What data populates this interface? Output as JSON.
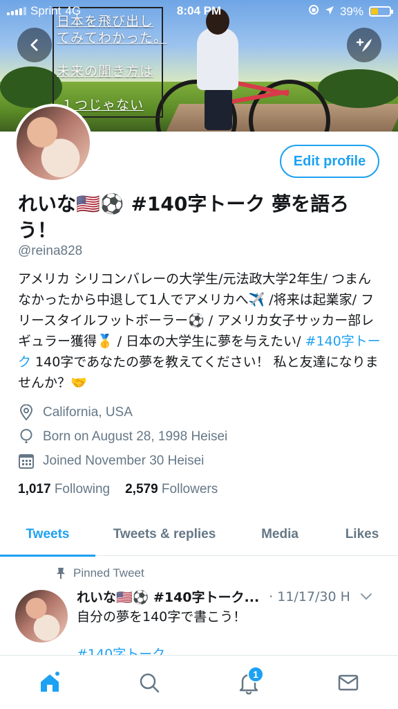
{
  "status_bar": {
    "carrier": "Sprint",
    "network": "4G",
    "time": "8:04 PM",
    "battery_percent": "39%",
    "battery_level": 0.39
  },
  "banner": {
    "lines": [
      "日本を飛び出し",
      "てみてわかった。",
      "未来の開き方は",
      "１つじゃない"
    ]
  },
  "profile": {
    "edit_label": "Edit profile",
    "name": "れいな🇺🇸⚽️ #140字トーク 夢を語ろう！",
    "handle": "@reina828",
    "bio_text": "アメリカ シリコンバレーの大学生/元法政大学2年生/ つまんなかったから中退して1人でアメリカへ✈️ /将来は起業家/ フリースタイルフットボーラー⚽️ / アメリカ女子サッカー部レギュラー獲得🥇 / 日本の大学生に夢を与えたい/ ",
    "bio_hashtag": "#140字トーク",
    "bio_text_after": " 140字であなたの夢を教えてください！ 私と友達になりませんか？🤝",
    "location": "California, USA",
    "birthday": "Born on August 28, 1998 Heisei",
    "joined": "Joined November 30 Heisei",
    "following_count": "1,017",
    "following_label": "Following",
    "followers_count": "2,579",
    "followers_label": "Followers"
  },
  "tabs": [
    "Tweets",
    "Tweets & replies",
    "Media",
    "Likes"
  ],
  "pinned_tweet": {
    "label": "Pinned Tweet",
    "author": "れいな🇺🇸⚽️ #140字トーク...",
    "date": "· 11/17/30 H",
    "text": "自分の夢を140字で書こう！",
    "hashtag": "#140字トーク"
  },
  "bottom_nav": {
    "notification_badge": "1"
  },
  "colors": {
    "accent": "#1da1f2",
    "secondary_text": "#657786",
    "primary_text": "#14171a"
  },
  "icons": [
    "back-arrow-icon",
    "compose-tweet-icon",
    "location-pin-icon",
    "birthday-balloon-icon",
    "calendar-icon",
    "pin-icon",
    "chevron-down-icon",
    "home-icon",
    "search-icon",
    "notifications-bell-icon",
    "messages-envelope-icon"
  ]
}
